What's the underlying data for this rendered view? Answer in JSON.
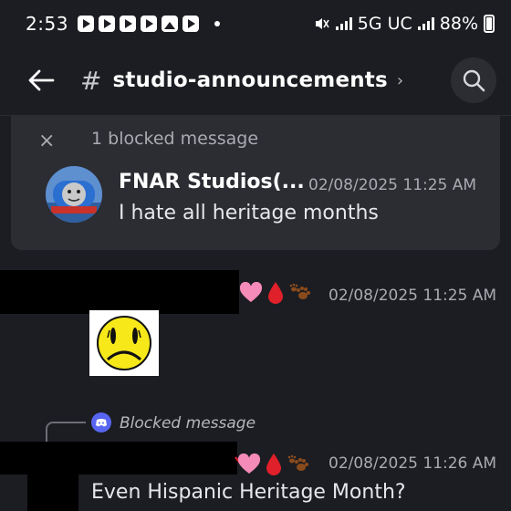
{
  "status_bar": {
    "time": "2:53",
    "network": "5G UC",
    "battery": "88%",
    "notification_icons": [
      "youtube-icon",
      "youtube-icon",
      "youtube-icon",
      "youtube-icon",
      "gallery-icon",
      "youtube-icon"
    ]
  },
  "header": {
    "hash": "#",
    "channel_name": "studio-announcements",
    "chevron": "›"
  },
  "blocked_panel": {
    "close": "×",
    "label": "1 blocked message",
    "message": {
      "author": "FNAR Studios(...",
      "timestamp": "02/08/2025 11:25 AM",
      "text": "I hate all heritage months"
    }
  },
  "messages": [
    {
      "timestamp": "02/08/2025 11:25 AM",
      "attachment": "frowning-face-image"
    },
    {
      "reply_to": "Blocked message",
      "timestamp": "02/08/2025 11:26 AM",
      "text": "Even Hispanic Heritage Month?"
    }
  ],
  "colors": {
    "background": "#1c1d22",
    "panel": "#2b2d33",
    "discord_blurple": "#5865f2"
  }
}
